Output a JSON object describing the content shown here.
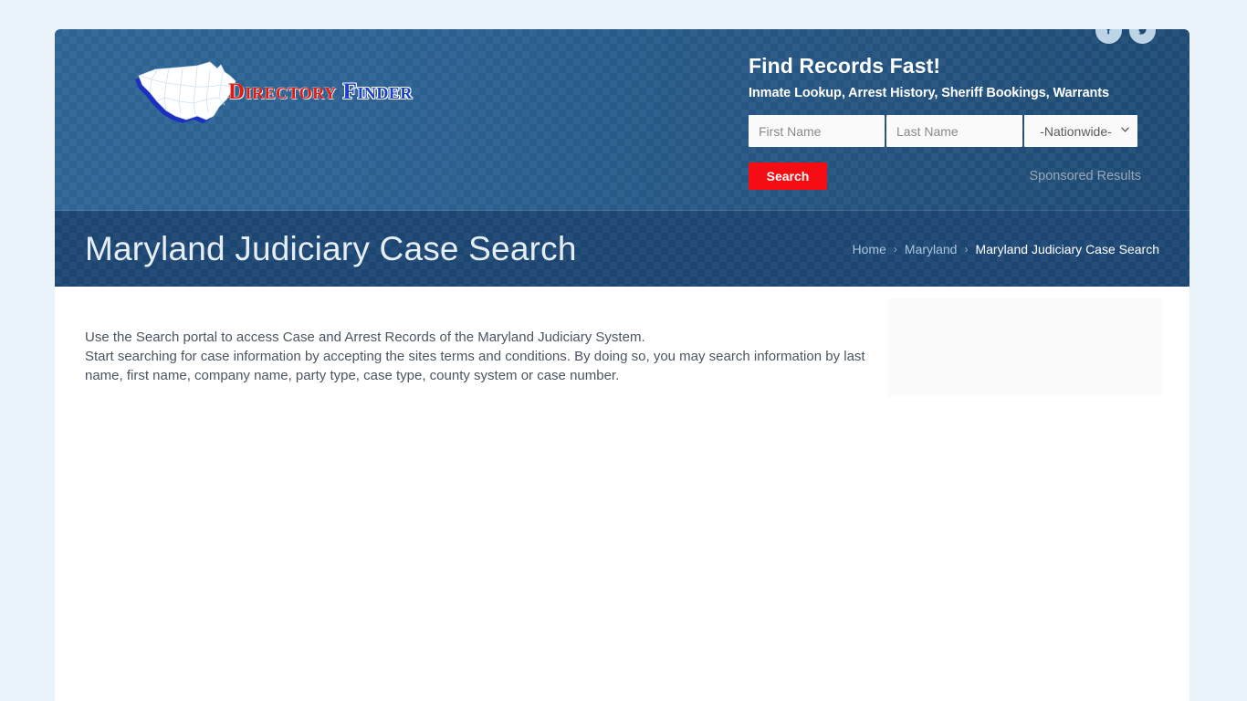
{
  "brand": {
    "logo_directory": "Directory",
    "logo_finder": "Finder",
    "map_icon": "usa-map-icon"
  },
  "social": [
    {
      "name": "facebook-icon",
      "label": "Facebook"
    },
    {
      "name": "twitter-icon",
      "label": "Twitter"
    }
  ],
  "search": {
    "headline": "Find Records Fast!",
    "subheadline": "Inmate Lookup, Arrest History, Sheriff Bookings, Warrants",
    "first_name_placeholder": "First Name",
    "first_name_value": "",
    "last_name_placeholder": "Last Name",
    "last_name_value": "",
    "state_selected": "-Nationwide-",
    "state_options": [
      "-Nationwide-"
    ],
    "button_label": "Search",
    "sponsored_label": "Sponsored Results",
    "button_color": "#f50d13"
  },
  "title_band": {
    "page_title": "Maryland Judiciary Case Search",
    "breadcrumb": [
      {
        "label": "Home",
        "current": false
      },
      {
        "label": "Maryland",
        "current": false
      },
      {
        "label": "Maryland Judiciary Case Search",
        "current": true
      }
    ],
    "separator": "›"
  },
  "content": {
    "paragraph_line_1": "Use the Search portal to access Case and Arrest Records of the Maryland Judiciary System.",
    "paragraph_line_2": "Start searching for case information by accepting the sites terms and conditions. By doing so, you may search information by last",
    "paragraph_line_3": "name, first name, company name, party type, case type, county system or case number."
  },
  "colors": {
    "header_blue": "#2b6090",
    "title_band_blue": "#1c4672",
    "page_background": "#e9f3f9",
    "logo_red": "#e11b12",
    "logo_blue": "#1b3fc4"
  }
}
